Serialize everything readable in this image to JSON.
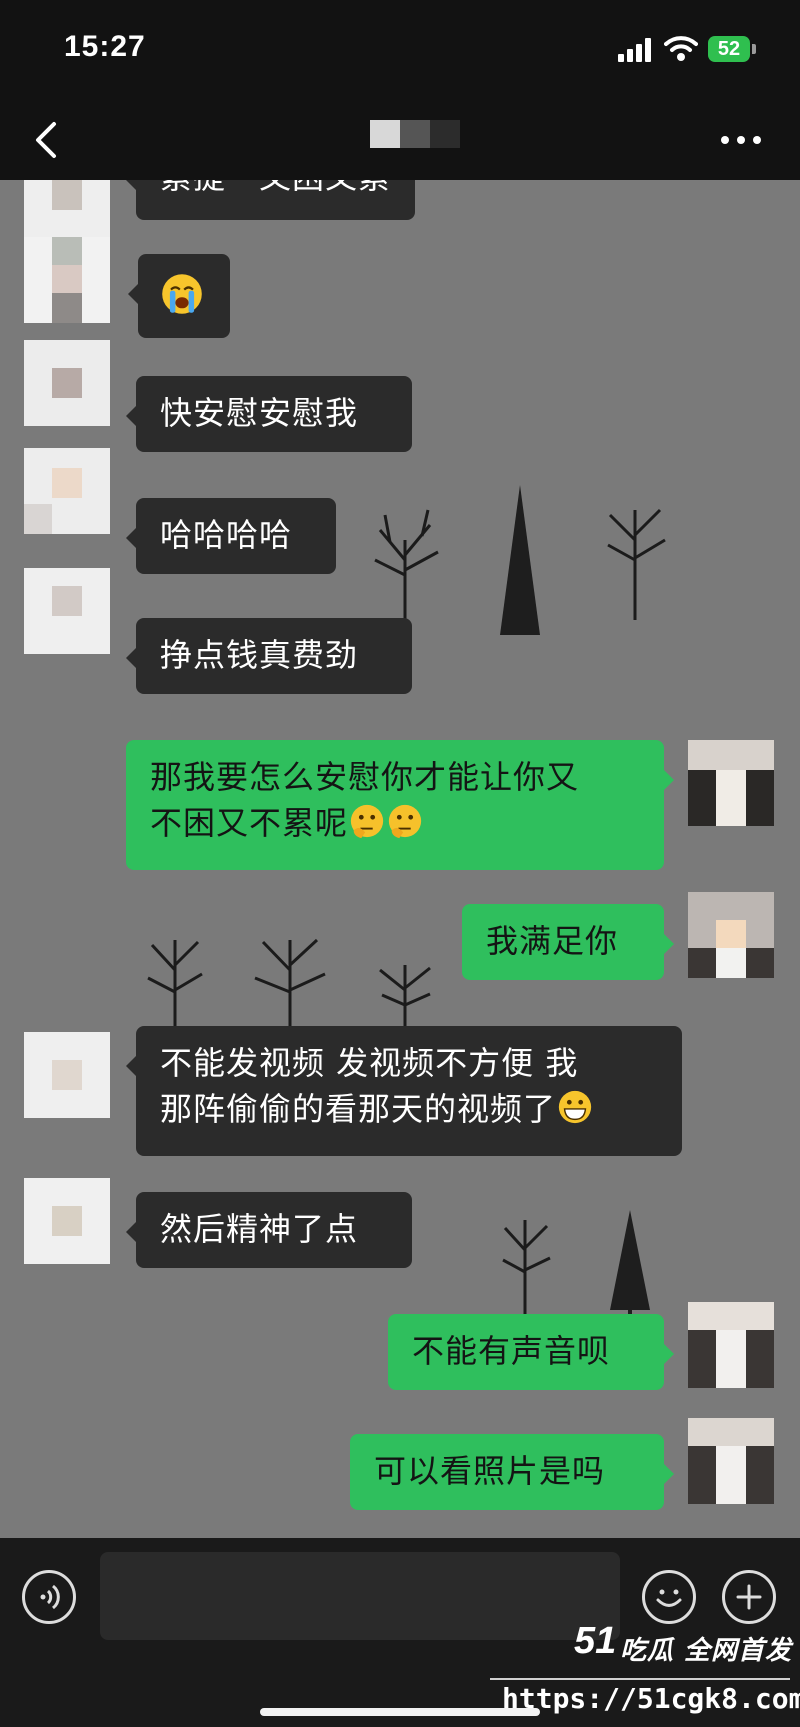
{
  "status_bar": {
    "time": "15:27",
    "battery": "52"
  },
  "header": {
    "title": ""
  },
  "messages": [
    {
      "side": "left",
      "text": "累提一又困又累"
    },
    {
      "side": "left",
      "text": ""
    },
    {
      "side": "left",
      "text": "快安慰安慰我"
    },
    {
      "side": "left",
      "text": "哈哈哈哈"
    },
    {
      "side": "left",
      "text": "挣点钱真费劲"
    },
    {
      "side": "right",
      "line1": "那我要怎么安慰你才能让你又",
      "line2": "不困又不累呢"
    },
    {
      "side": "right",
      "text": "我满足你"
    },
    {
      "side": "left",
      "line1": "不能发视频  发视频不方便  我",
      "line2": "那阵偷偷的看那天的视频了"
    },
    {
      "side": "left",
      "text": "然后精神了点"
    },
    {
      "side": "right",
      "text": "不能有声音呗"
    },
    {
      "side": "right",
      "text": "可以看照片是吗"
    }
  ],
  "input": {
    "placeholder": ""
  },
  "watermark": {
    "brand": "51",
    "slogan": "吃瓜 全网首发",
    "url": "https://51cgk8.com"
  }
}
